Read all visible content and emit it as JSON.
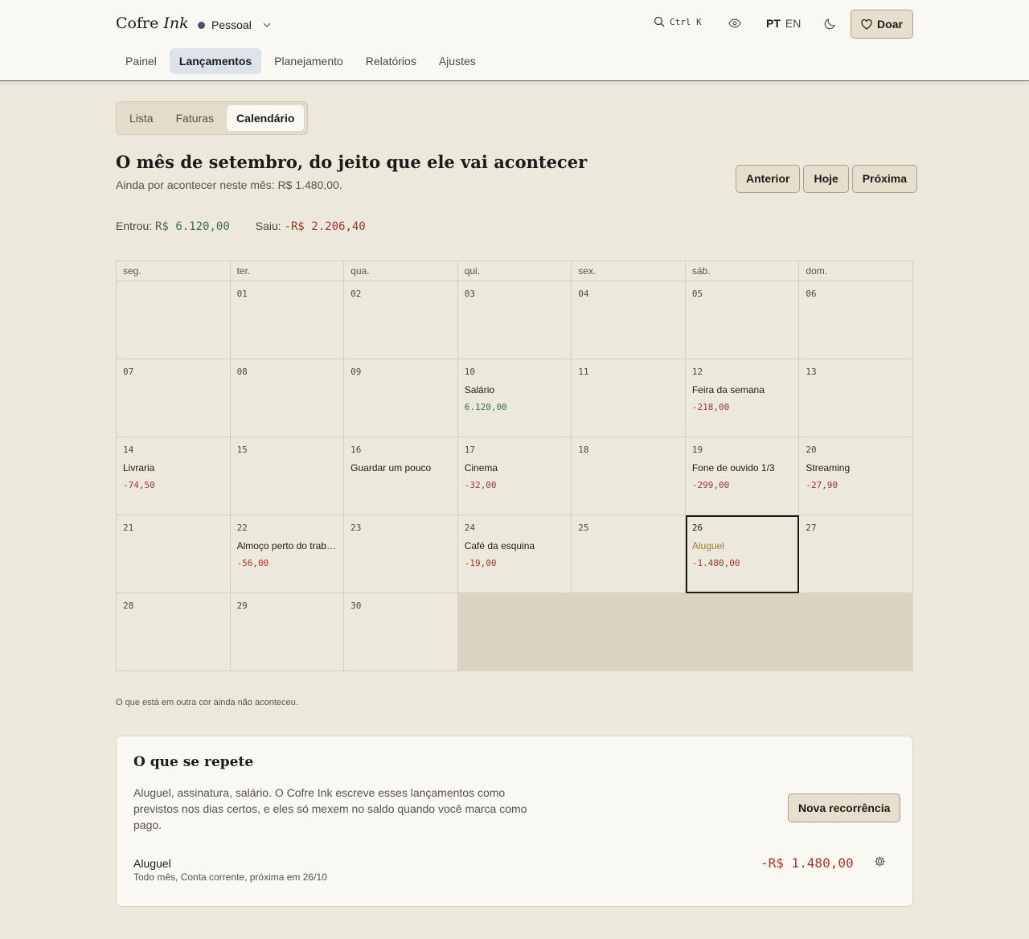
{
  "header": {
    "brand_prefix": "Cofre",
    "brand_italic": "Ink",
    "profile": "Pessoal",
    "search_hint": "Ctrl K",
    "lang_active": "PT",
    "lang_other": "EN",
    "donate_label": "Doar",
    "nav": [
      "Painel",
      "Lançamentos",
      "Planejamento",
      "Relatórios",
      "Ajustes"
    ],
    "nav_active": "Lançamentos"
  },
  "view_tabs": [
    "Lista",
    "Faturas",
    "Calendário"
  ],
  "view_active": "Calendário",
  "calendar": {
    "heading": "O mês de setembro, do jeito que ele vai acontecer",
    "subheading": "Ainda por acontecer neste mês: R$ 1.480,00.",
    "nav_prev": "Anterior",
    "nav_today": "Hoje",
    "nav_next": "Próxima",
    "income_label": "Entrou:",
    "income_value": "R$ 6.120,00",
    "expense_label": "Saiu:",
    "expense_value": "-R$ 2.206,40",
    "weekdays": [
      "seg.",
      "ter.",
      "qua.",
      "qui.",
      "sex.",
      "sáb.",
      "dom."
    ],
    "leading_blank_days": 1,
    "days_in_month": 30,
    "today": 26,
    "events": [
      {
        "day": 10,
        "label": "Salário",
        "amount": "6.120,00",
        "kind": "income"
      },
      {
        "day": 12,
        "label": "Feira da semana",
        "amount": "-218,00",
        "kind": "expense"
      },
      {
        "day": 14,
        "label": "Livraria",
        "amount": "-74,50",
        "kind": "expense"
      },
      {
        "day": 16,
        "label": "Guardar um pouco",
        "amount": "",
        "kind": "transfer"
      },
      {
        "day": 17,
        "label": "Cinema",
        "amount": "-32,00",
        "kind": "expense"
      },
      {
        "day": 19,
        "label": "Fone de ouvido 1/3",
        "amount": "-299,00",
        "kind": "expense"
      },
      {
        "day": 20,
        "label": "Streaming",
        "amount": "-27,90",
        "kind": "expense"
      },
      {
        "day": 22,
        "label": "Almoço perto do trabalho",
        "amount": "-56,00",
        "kind": "expense"
      },
      {
        "day": 24,
        "label": "Café da esquina",
        "amount": "-19,00",
        "kind": "expense"
      },
      {
        "day": 26,
        "label": "Aluguel",
        "amount": "-1.480,00",
        "kind": "expense",
        "planned": true
      }
    ],
    "footnote": "O que está em outra cor ainda não aconteceu."
  },
  "recurring": {
    "title": "O que se repete",
    "description": "Aluguel, assinatura, salário. O Cofre Ink escreve esses lançamentos como previstos nos dias certos, e eles só mexem no saldo quando você marca como pago.",
    "new_button": "Nova recorrência",
    "items": [
      {
        "name": "Aluguel",
        "meta": "Todo mês, Conta corrente, próxima em 26/10",
        "amount": "-R$ 1.480,00"
      }
    ]
  },
  "colors": {
    "income": "#3f6b52",
    "expense": "#a3352a",
    "planned": "#9b7b3c",
    "accent_nav": "#dde2eb"
  }
}
